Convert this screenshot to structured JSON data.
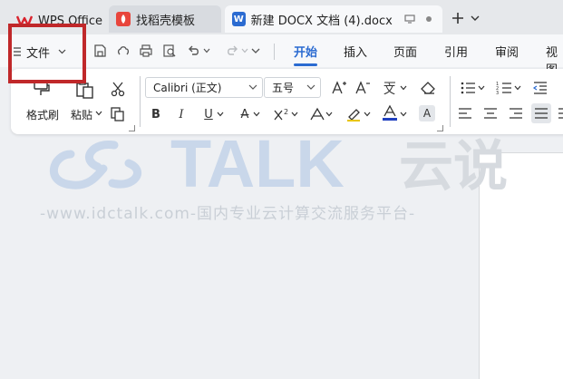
{
  "tabs": [
    {
      "label": "WPS Office",
      "icon": "wps-logo-icon"
    },
    {
      "label": "找稻壳模板",
      "icon": "docer-icon"
    },
    {
      "label": "新建 DOCX 文档 (4).docx",
      "icon": "word-doc-icon"
    }
  ],
  "menu": {
    "file_label": "文件",
    "ribbon_tabs": [
      "开始",
      "插入",
      "页面",
      "引用",
      "审阅",
      "视图"
    ]
  },
  "ribbon": {
    "format_painter": "格式刷",
    "paste": "粘贴",
    "font_name": "Calibri (正文)",
    "font_size": "五号"
  },
  "watermark": {
    "brand": "TALK",
    "brand_cn": "云说",
    "url": "-www.idctalk.com-国内专业云计算交流服务平台-"
  },
  "colors": {
    "accent": "#2b6bd1",
    "highlight": "#c0282a",
    "font_color": "#1f3fbf"
  }
}
